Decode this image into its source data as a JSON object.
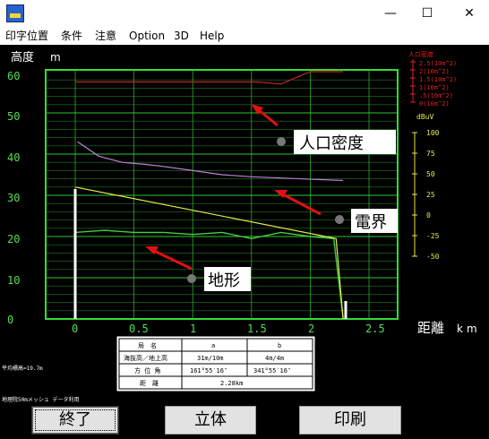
{
  "window": {
    "minimize_glyph": "—",
    "maximize_glyph": "☐",
    "close_glyph": "✕"
  },
  "menu": [
    "印字位置",
    "条件",
    "注意",
    "Option",
    "3D",
    "Help"
  ],
  "axes": {
    "y_title": "高度",
    "y_unit": "m",
    "y_ticks": [
      "60",
      "50",
      "40",
      "30",
      "20",
      "10",
      "0"
    ],
    "x_ticks": [
      "0",
      "0.5",
      "1",
      "1.5",
      "2",
      "2.5"
    ],
    "x_title": "距離",
    "x_unit": "km"
  },
  "legend_pop": {
    "title": "人口密度",
    "items": [
      "2.5(10m^2)",
      "2(10m^2)",
      "1.5(10m^2)",
      "1(10m^2)",
      ".5(10m^2)",
      "0(10m^2)"
    ]
  },
  "field_axis": {
    "unit": "dBuV",
    "ticks": [
      "100",
      "75",
      "50",
      "25",
      "0",
      "-25",
      "-50"
    ]
  },
  "annotations": {
    "population": "人口密度",
    "field": "電界",
    "terrain": "地形"
  },
  "info_table": {
    "headers": [
      "局　名",
      "a",
      "b"
    ],
    "rows": [
      [
        "海抜高／地上高",
        "31m/10m",
        "4m/4m"
      ],
      [
        "方 位 角",
        "161°55′16″",
        "341°55′16″"
      ],
      [
        "距　離",
        "2.28km",
        ""
      ]
    ]
  },
  "side_notes": {
    "avg_height": "平均標高=19.7m",
    "source": "地理院50mメッシュ データ利用"
  },
  "buttons": {
    "end": "終了",
    "solid": "立体",
    "print": "印刷"
  },
  "colors": {
    "frame": "#33dd33",
    "terrain": "#44cc44",
    "field": "#e8e84a",
    "population": "#cc2222",
    "density": "#c080d8",
    "accent_red": "#e01010"
  },
  "chart_data": [
    {
      "type": "line",
      "series": [
        {
          "name": "地形",
          "x": [
            0.0,
            0.25,
            0.5,
            0.75,
            1.0,
            1.25,
            1.5,
            1.75,
            2.0,
            2.2,
            2.28
          ],
          "values": [
            21,
            21.5,
            21,
            21,
            20.5,
            21,
            19.5,
            21,
            20,
            19.5,
            0
          ]
        },
        {
          "name": "電界",
          "x": [
            0.0,
            2.22,
            2.28
          ],
          "values": [
            32,
            19.5,
            0
          ]
        },
        {
          "name": "人口密度",
          "x": [
            0.0,
            1.55,
            1.75,
            2.0,
            2.28
          ],
          "values": [
            57.5,
            57.5,
            57,
            60,
            60
          ]
        },
        {
          "x": [
            0.02,
            0.2,
            0.4,
            0.6,
            0.75,
            1.0,
            1.25,
            1.5,
            1.75,
            2.0,
            2.28
          ],
          "values": [
            43,
            39.5,
            38,
            37.5,
            37,
            36,
            35,
            34.5,
            34.2,
            33.9,
            33.6
          ]
        }
      ],
      "title": "",
      "xlabel": "距離 km",
      "ylabel": "高度 m",
      "xlim": [
        0,
        2.6
      ],
      "ylim": [
        0,
        60
      ]
    }
  ]
}
